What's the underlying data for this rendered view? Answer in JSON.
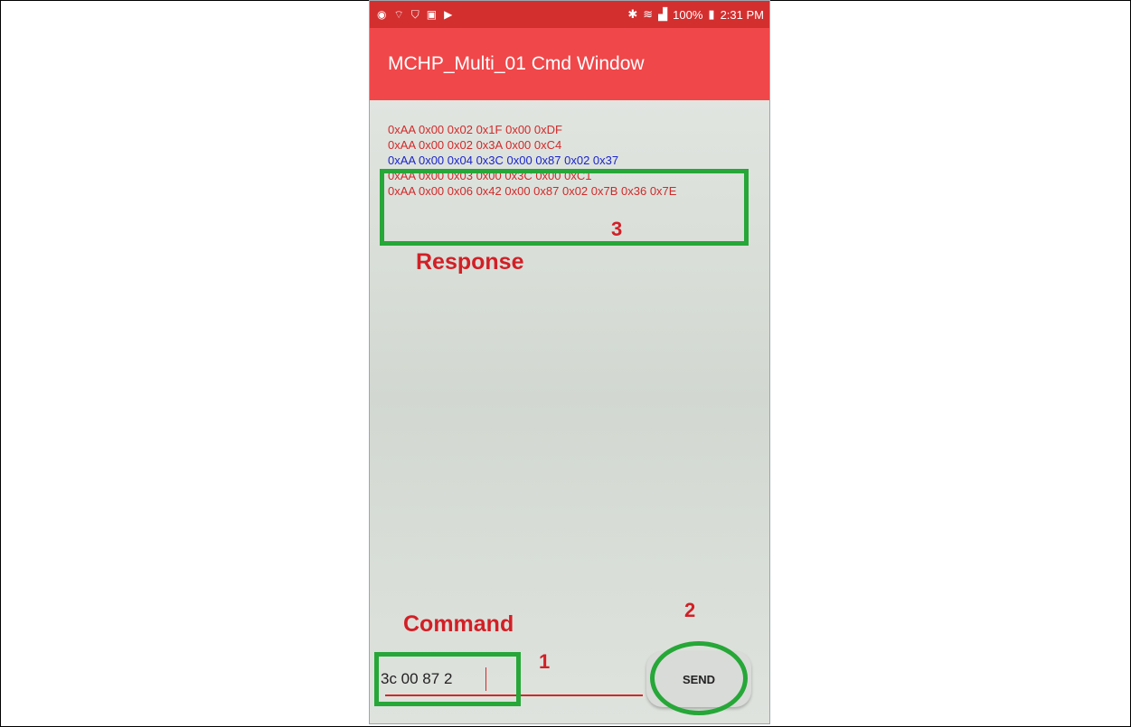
{
  "status_bar": {
    "left_icons": [
      "compass-icon",
      "wifi-calling-icon",
      "shield-icon",
      "clipboard-icon",
      "play-store-icon"
    ],
    "right_icons": [
      "bluetooth-icon",
      "wifi-icon",
      "signal-icon"
    ],
    "battery": "100%",
    "time": "2:31 PM",
    "color": "#d32f2f"
  },
  "app_bar": {
    "title": "MCHP_Multi_01 Cmd Window",
    "color": "#f0474a"
  },
  "log": [
    {
      "text": "0xAA 0x00 0x02 0x1F 0x00 0xDF",
      "color": "red"
    },
    {
      "text": "0xAA 0x00 0x02 0x3A 0x00 0xC4",
      "color": "red"
    },
    {
      "text": "0xAA 0x00 0x04 0x3C 0x00 0x87 0x02 0x37",
      "color": "blue"
    },
    {
      "text": "0xAA 0x00 0x03 0x00 0x3C 0x00 0xC1",
      "color": "red"
    },
    {
      "text": "0xAA 0x00 0x06 0x42 0x00 0x87 0x02 0x7B 0x36 0x7E",
      "color": "red"
    }
  ],
  "annotations": {
    "response_label": "Response",
    "command_label": "Command",
    "marker_1": "1",
    "marker_2": "2",
    "marker_3": "3",
    "highlight_color": "#26a738",
    "label_color": "#d21f26"
  },
  "command_input": {
    "value": "3c 00 87 2"
  },
  "send_button": {
    "label": "SEND"
  }
}
